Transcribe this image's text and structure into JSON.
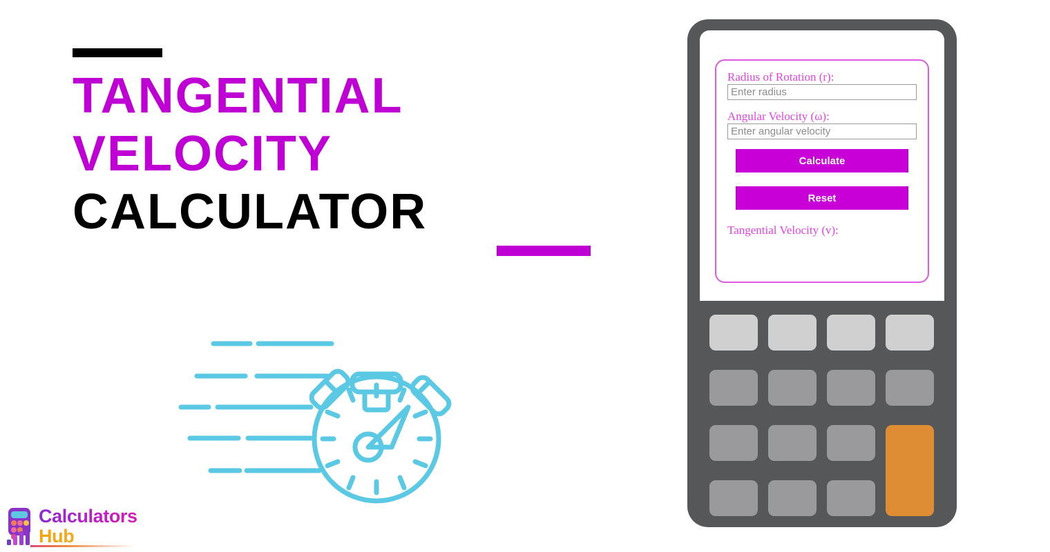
{
  "page": {
    "background_color": "#ffffff",
    "accent_magenta": "#bf00d4",
    "accent_black": "#000000",
    "accent_cyan": "#5bc8e4",
    "accent_orange": "#df8d35"
  },
  "title": {
    "line1": "Tangential",
    "line2": "Velocity",
    "line3": "Calculator",
    "rule_top_color": "#000000",
    "rule_bottom_color": "#bf00d4"
  },
  "illustration": {
    "name": "stopwatch-speed-icon",
    "stroke_color": "#5bc8e4",
    "speed_line_count": 5
  },
  "logo": {
    "word1": "Calculators",
    "word2": "Hub",
    "mark_name": "calculator-bar-chart-icon",
    "word1_color": "#bf1fc6",
    "word2_color": "#f3a412"
  },
  "calculator": {
    "frame_color": "#555759",
    "screen_color": "#ffffff",
    "card_border_color": "#e05ae0",
    "fields": [
      {
        "label": "Radius of Rotation (r):",
        "placeholder": "Enter radius",
        "value": ""
      },
      {
        "label": "Angular Velocity (ω):",
        "placeholder": "Enter angular velocity",
        "value": ""
      }
    ],
    "buttons": {
      "calculate": "Calculate",
      "reset": "Reset",
      "color": "#c800d7",
      "text_color": "#ffffff"
    },
    "result": {
      "label": "Tangential Velocity (v):",
      "value": ""
    },
    "keypad": {
      "columns": 4,
      "rows": 4,
      "top_row_color": "#d0d0d0",
      "key_color": "#9a9a9c",
      "accent_key_color": "#df8d35",
      "accent_key_span_rows": 2
    }
  }
}
